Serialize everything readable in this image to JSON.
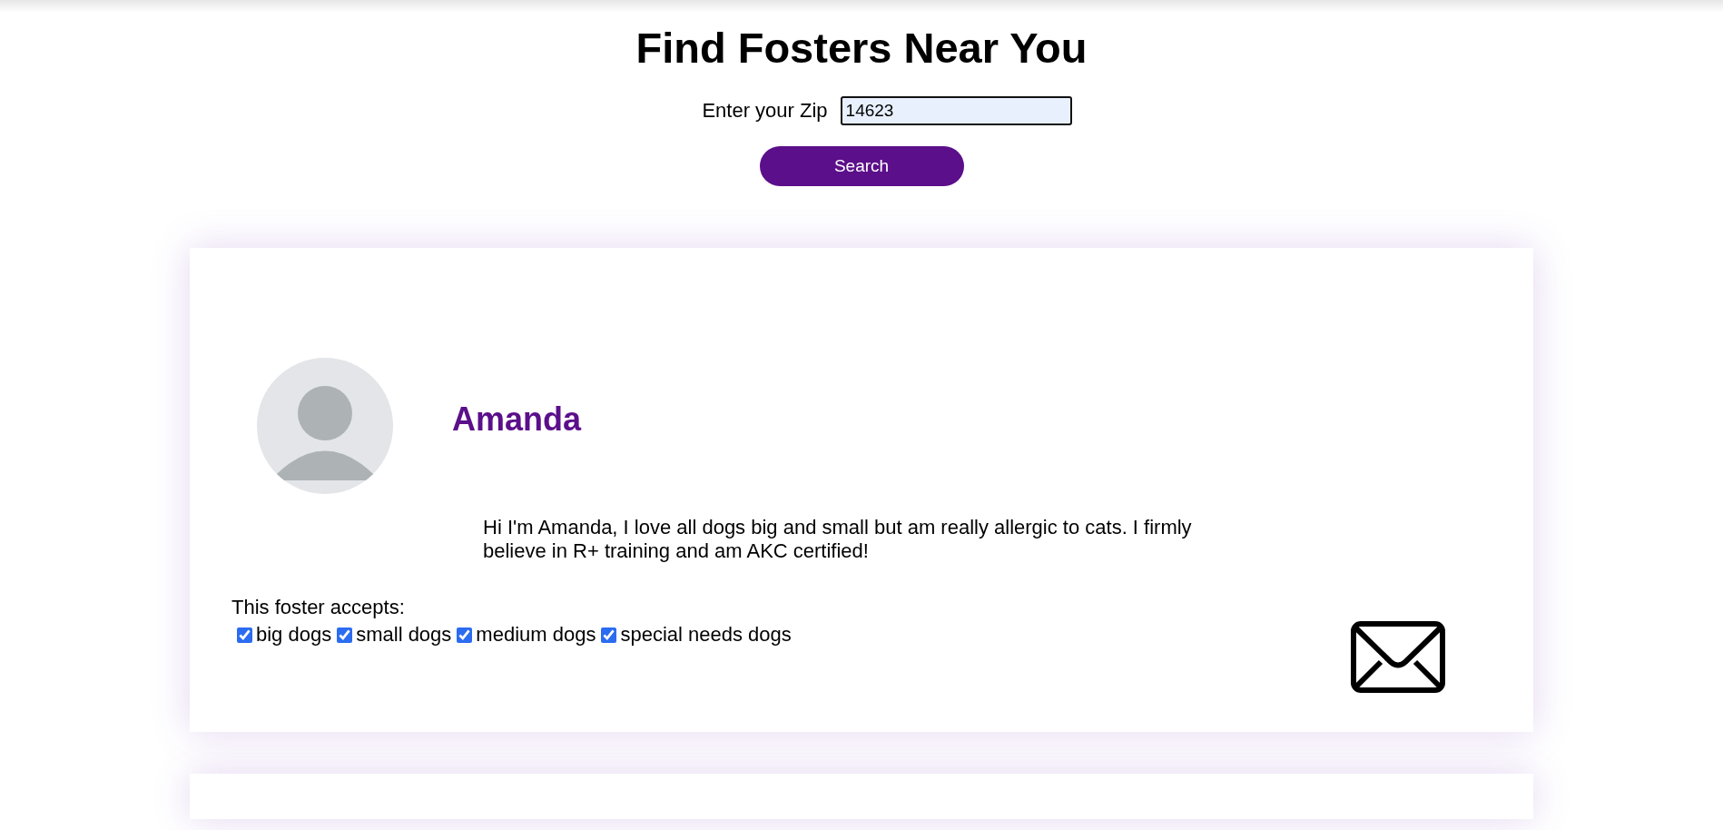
{
  "title": "Find Fosters Near You",
  "zip": {
    "label": "Enter your Zip",
    "value": "14623"
  },
  "search_button": "Search",
  "fosters": [
    {
      "kind": "profile",
      "name": "Amanda",
      "bio": "Hi I'm Amanda, I love all dogs big and small but am really allergic to cats. I firmly believe in R+ training and am AKC certified!",
      "accepts_label": "This foster accepts:",
      "accepts": [
        {
          "label": "big dogs",
          "checked": true
        },
        {
          "label": "small dogs",
          "checked": true
        },
        {
          "label": "medium dogs",
          "checked": true
        },
        {
          "label": "special needs dogs",
          "checked": true
        }
      ]
    },
    {
      "kind": "cut_off"
    }
  ]
}
